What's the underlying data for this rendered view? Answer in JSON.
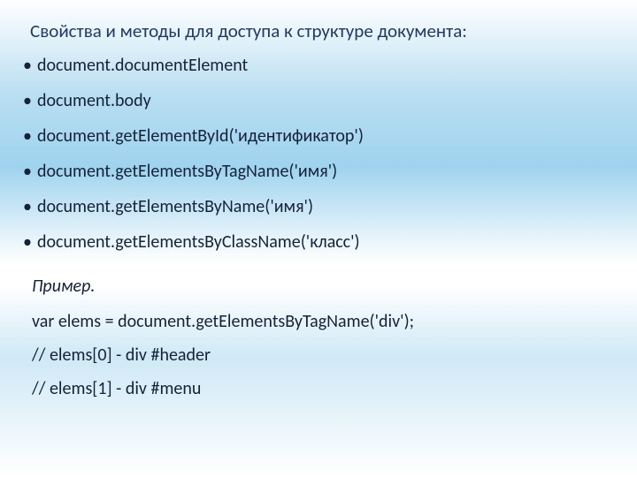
{
  "heading": "Свойства и методы для доступа к структуре документа:",
  "items": [
    "document.documentElement",
    "document.body",
    "document.getElementById('идентификатор')",
    "document.getElementsByTagName('имя')",
    "document.getElementsByName('имя')",
    "document.getElementsByClassName('класс')"
  ],
  "example": {
    "label": "Пример.",
    "lines": [
      "var elems = document.getElementsByTagName('div');",
      "//   elems[0] - div #header",
      "//   elems[1] - div #menu"
    ]
  }
}
